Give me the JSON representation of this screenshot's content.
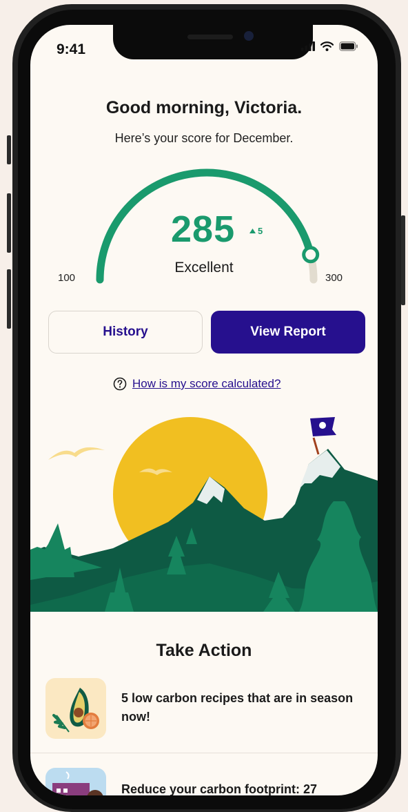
{
  "status_bar": {
    "time": "9:41",
    "icons": [
      "signal-icon",
      "wifi-icon",
      "battery-icon"
    ]
  },
  "header": {
    "greeting": "Good morning, Victoria.",
    "subtitle": "Here’s your score for December."
  },
  "score": {
    "value": "285",
    "change": "5",
    "change_direction": "up",
    "rating": "Excellent",
    "min": "100",
    "max": "300",
    "fraction": 0.925
  },
  "buttons": {
    "history": "History",
    "view_report": "View Report"
  },
  "help": {
    "icon": "question-circle-icon",
    "text": "How is my score calculated?"
  },
  "take_action": {
    "title": "Take Action",
    "items": [
      {
        "text": "5 low carbon recipes that are in season now!",
        "icon": "avocado-icon"
      },
      {
        "text": "Reduce your carbon footprint: 27",
        "icon": "home-icon"
      }
    ]
  },
  "colors": {
    "accent_green": "#1a9a6d",
    "brand_indigo": "#26108e",
    "track_beige": "#e2dccf",
    "background": "#fdf9f3"
  }
}
